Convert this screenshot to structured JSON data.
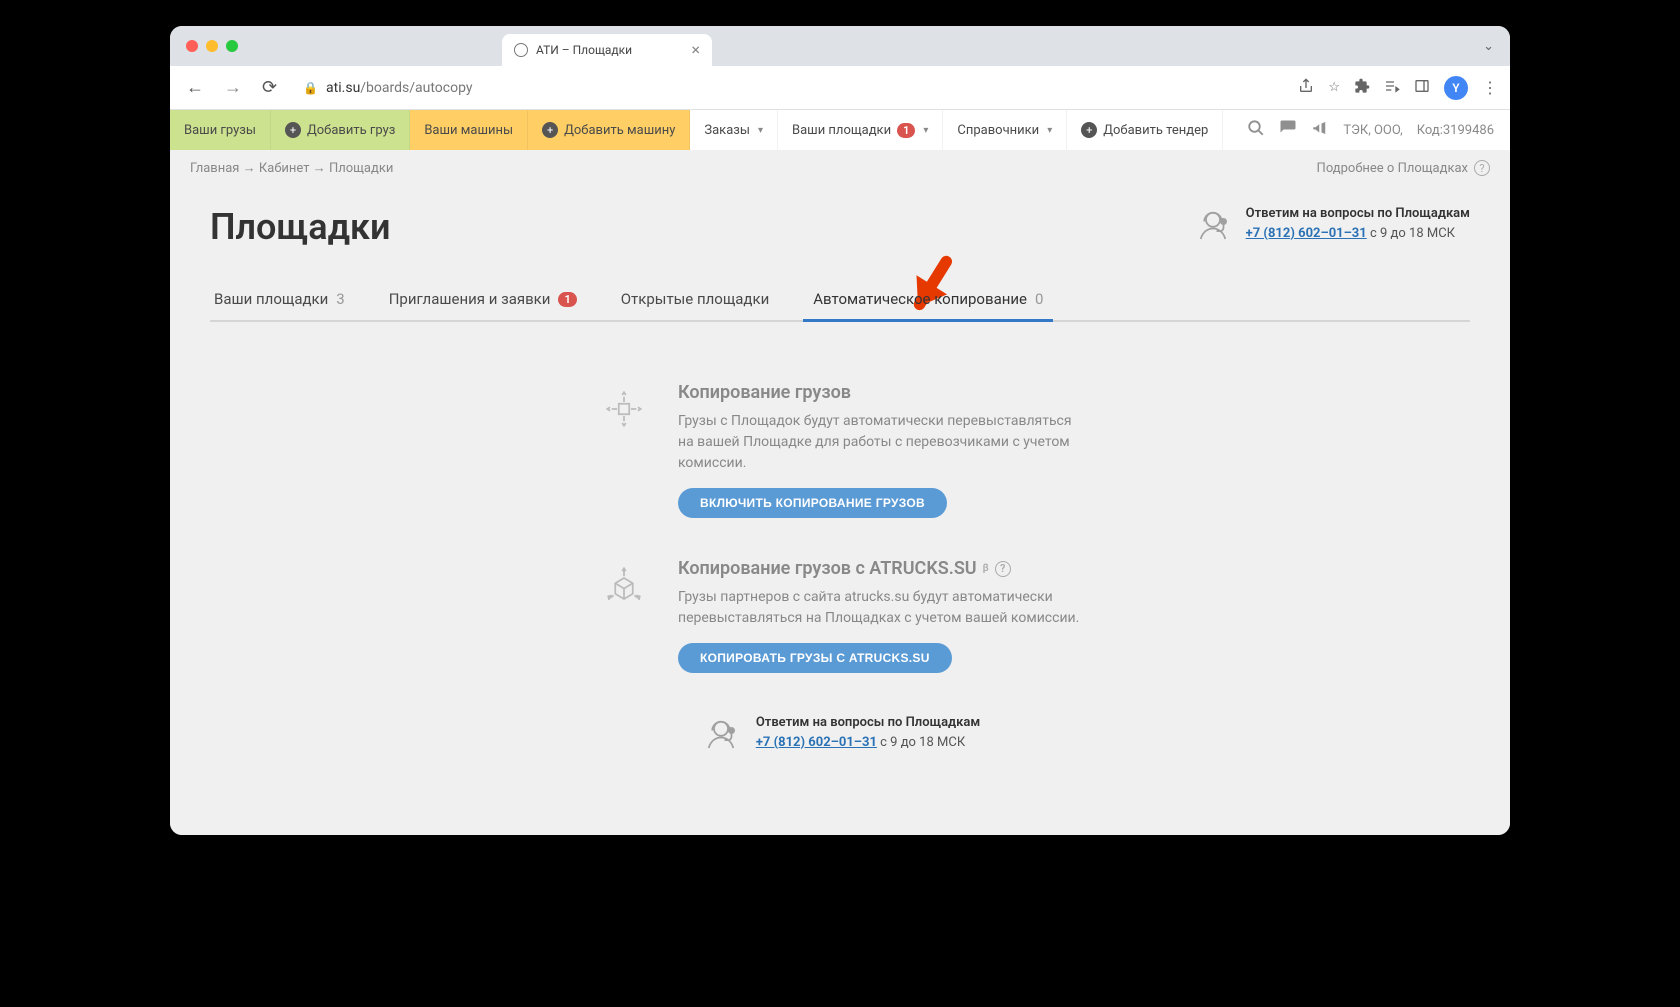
{
  "browser": {
    "tab_title": "АТИ – Площадки",
    "url_domain": "ati.su",
    "url_path": "/boards/autocopy",
    "avatar_letter": "Y"
  },
  "nav": {
    "your_cargo": "Ваши грузы",
    "add_cargo": "Добавить груз",
    "your_trucks": "Ваши машины",
    "add_truck": "Добавить машину",
    "orders": "Заказы",
    "your_boards": "Ваши площадки",
    "boards_badge": "1",
    "refs": "Справочники",
    "add_tender": "Добавить тендер",
    "org_name": "ТЭК, ООО,",
    "code_label": "Код:3199486"
  },
  "breadcrumb": {
    "home": "Главная",
    "cabinet": "Кабинет",
    "boards": "Площадки",
    "more_about": "Подробнее о Площадках"
  },
  "page_title": "Площадки",
  "support": {
    "title": "Ответим на вопросы по Площадкам",
    "phone": "+7 (812) 602–01–31",
    "hours": "с 9 до 18 МСК"
  },
  "tabs": {
    "boards": {
      "label": "Ваши площадки",
      "count": "3"
    },
    "invites": {
      "label": "Приглашения и заявки",
      "badge": "1"
    },
    "open": {
      "label": "Открытые площадки"
    },
    "autocopy": {
      "label": "Автоматическое копирование",
      "count": "0"
    }
  },
  "sections": {
    "copy_cargo": {
      "title": "Копирование грузов",
      "desc": "Грузы с Площадок будут автоматически перевыставляться на вашей Площадке для работы с перевозчиками с учетом комиссии.",
      "button": "ВКЛЮЧИТЬ КОПИРОВАНИЕ ГРУЗОВ"
    },
    "atrucks": {
      "title": "Копирование грузов с ATRUCKS.SU",
      "badge": "β",
      "desc": "Грузы партнеров с сайта atrucks.su будут автоматически перевыставляться на Площадках с учетом вашей комиссии.",
      "button": "КОПИРОВАТЬ ГРУЗЫ С ATRUCKS.SU"
    }
  }
}
